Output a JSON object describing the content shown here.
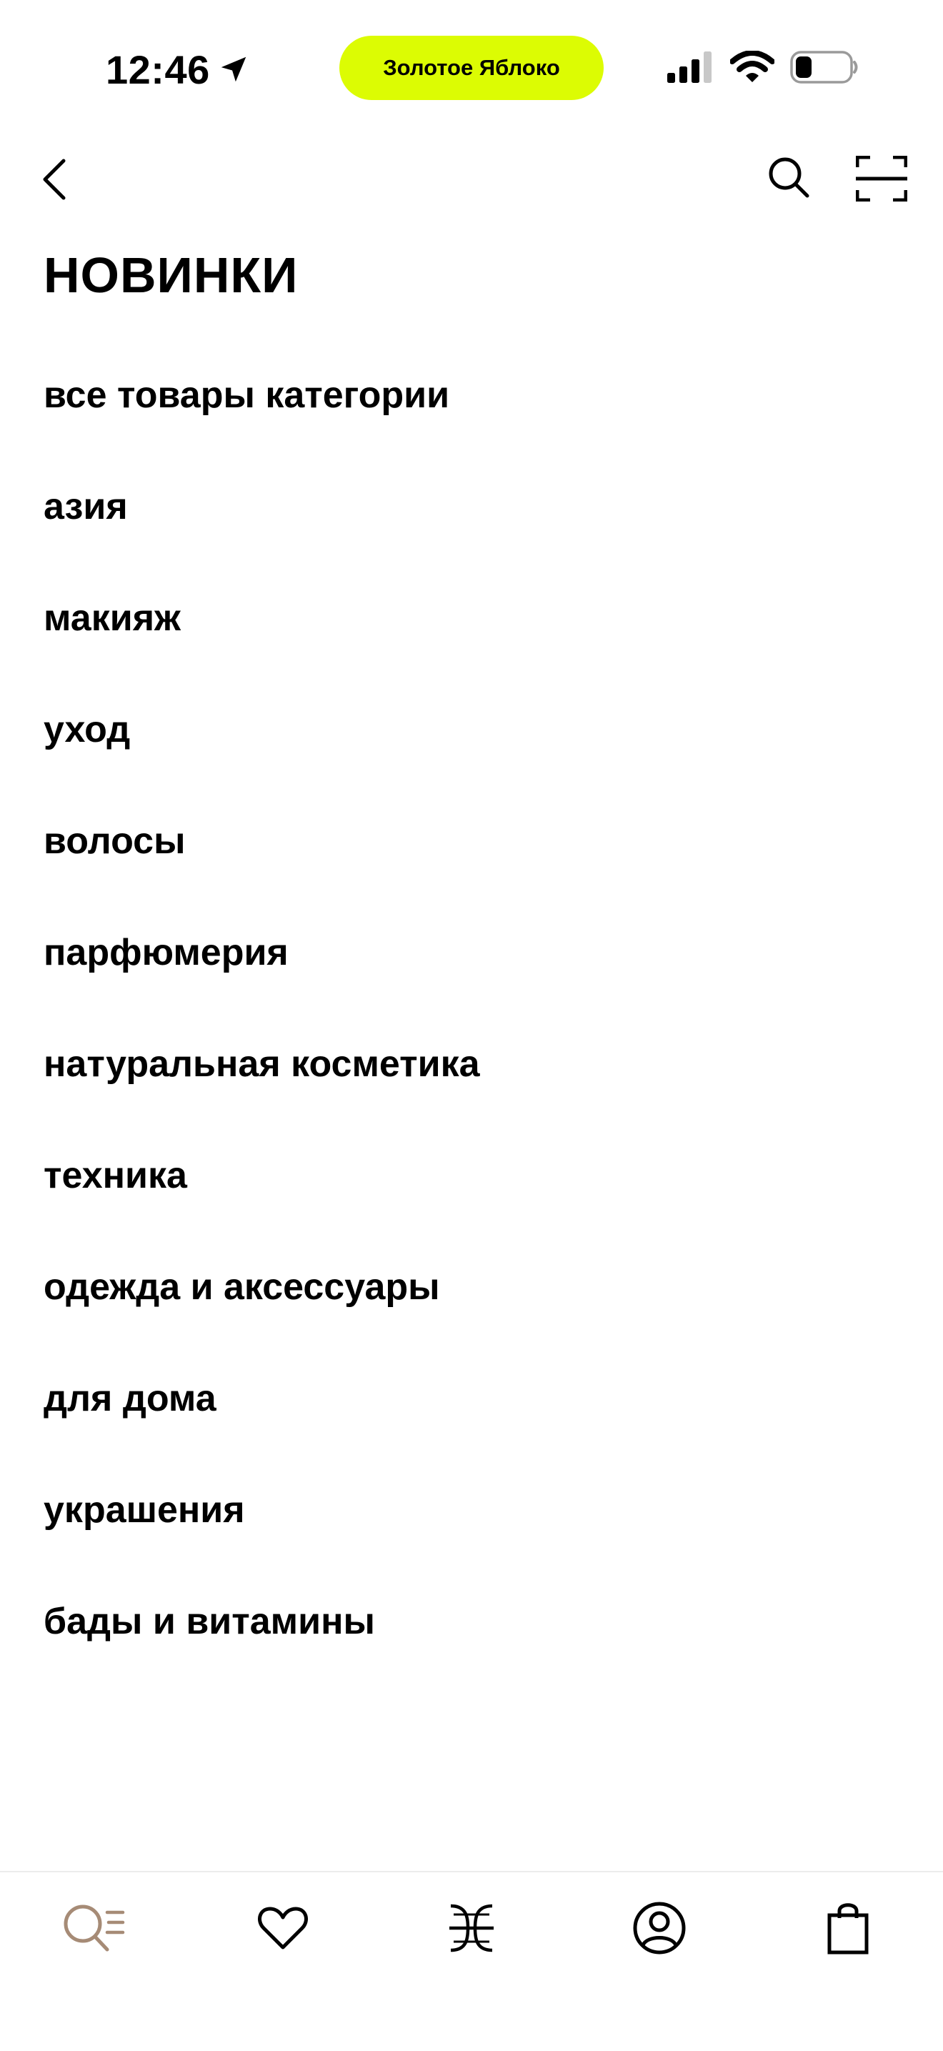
{
  "status_bar": {
    "time": "12:46",
    "app_pill_label": "Золотое Яблоко",
    "icons": [
      "location-arrow-icon",
      "cellular-signal-icon",
      "wifi-icon",
      "battery-icon"
    ]
  },
  "header": {
    "icons": [
      "chevron-left-icon",
      "search-icon",
      "scan-icon"
    ]
  },
  "page": {
    "title": "НОВИНКИ"
  },
  "categories": [
    {
      "label": "все товары категории"
    },
    {
      "label": "азия"
    },
    {
      "label": "макияж"
    },
    {
      "label": "уход"
    },
    {
      "label": "волосы"
    },
    {
      "label": "парфюмерия"
    },
    {
      "label": "натуральная косметика"
    },
    {
      "label": "техника"
    },
    {
      "label": "одежда и аксессуары"
    },
    {
      "label": "для дома"
    },
    {
      "label": "украшения"
    },
    {
      "label": "бады и витамины"
    }
  ],
  "tab_bar": {
    "tabs": [
      {
        "icon": "catalog-search-icon",
        "active": true
      },
      {
        "icon": "heart-icon",
        "active": false
      },
      {
        "icon": "brand-logo-icon",
        "active": false
      },
      {
        "icon": "profile-icon",
        "active": false
      },
      {
        "icon": "shopping-bag-icon",
        "active": false
      }
    ]
  },
  "colors": {
    "accent_pill": "#dcfc03",
    "active_tab": "#a68b76",
    "text": "#000000",
    "divider": "#ececec"
  }
}
